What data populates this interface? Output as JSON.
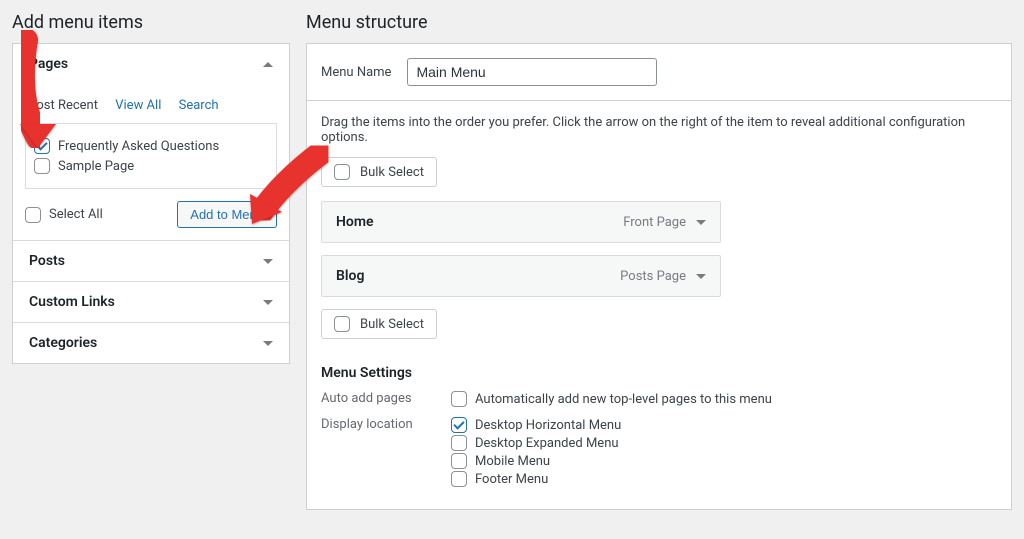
{
  "left": {
    "heading": "Add menu items",
    "accordion": [
      {
        "title": "Pages",
        "expanded": true
      },
      {
        "title": "Posts",
        "expanded": false
      },
      {
        "title": "Custom Links",
        "expanded": false
      },
      {
        "title": "Categories",
        "expanded": false
      }
    ],
    "tabs": [
      "Most Recent",
      "View All",
      "Search"
    ],
    "pages": [
      {
        "label": "Frequently Asked Questions",
        "checked": true
      },
      {
        "label": "Sample Page",
        "checked": false
      }
    ],
    "select_all": "Select All",
    "add_btn": "Add to Menu"
  },
  "right": {
    "heading": "Menu structure",
    "menu_name_label": "Menu Name",
    "menu_name": "Main Menu",
    "tip": "Drag the items into the order you prefer. Click the arrow on the right of the item to reveal additional configuration options.",
    "bulk": "Bulk Select",
    "items": [
      {
        "title": "Home",
        "type": "Front Page"
      },
      {
        "title": "Blog",
        "type": "Posts Page"
      }
    ],
    "settings_heading": "Menu Settings",
    "auto_add_label": "Auto add pages",
    "auto_add_text": "Automatically add new top-level pages to this menu",
    "display_label": "Display location",
    "locations": [
      {
        "label": "Desktop Horizontal Menu",
        "checked": true
      },
      {
        "label": "Desktop Expanded Menu",
        "checked": false
      },
      {
        "label": "Mobile Menu",
        "checked": false
      },
      {
        "label": "Footer Menu",
        "checked": false
      }
    ]
  }
}
